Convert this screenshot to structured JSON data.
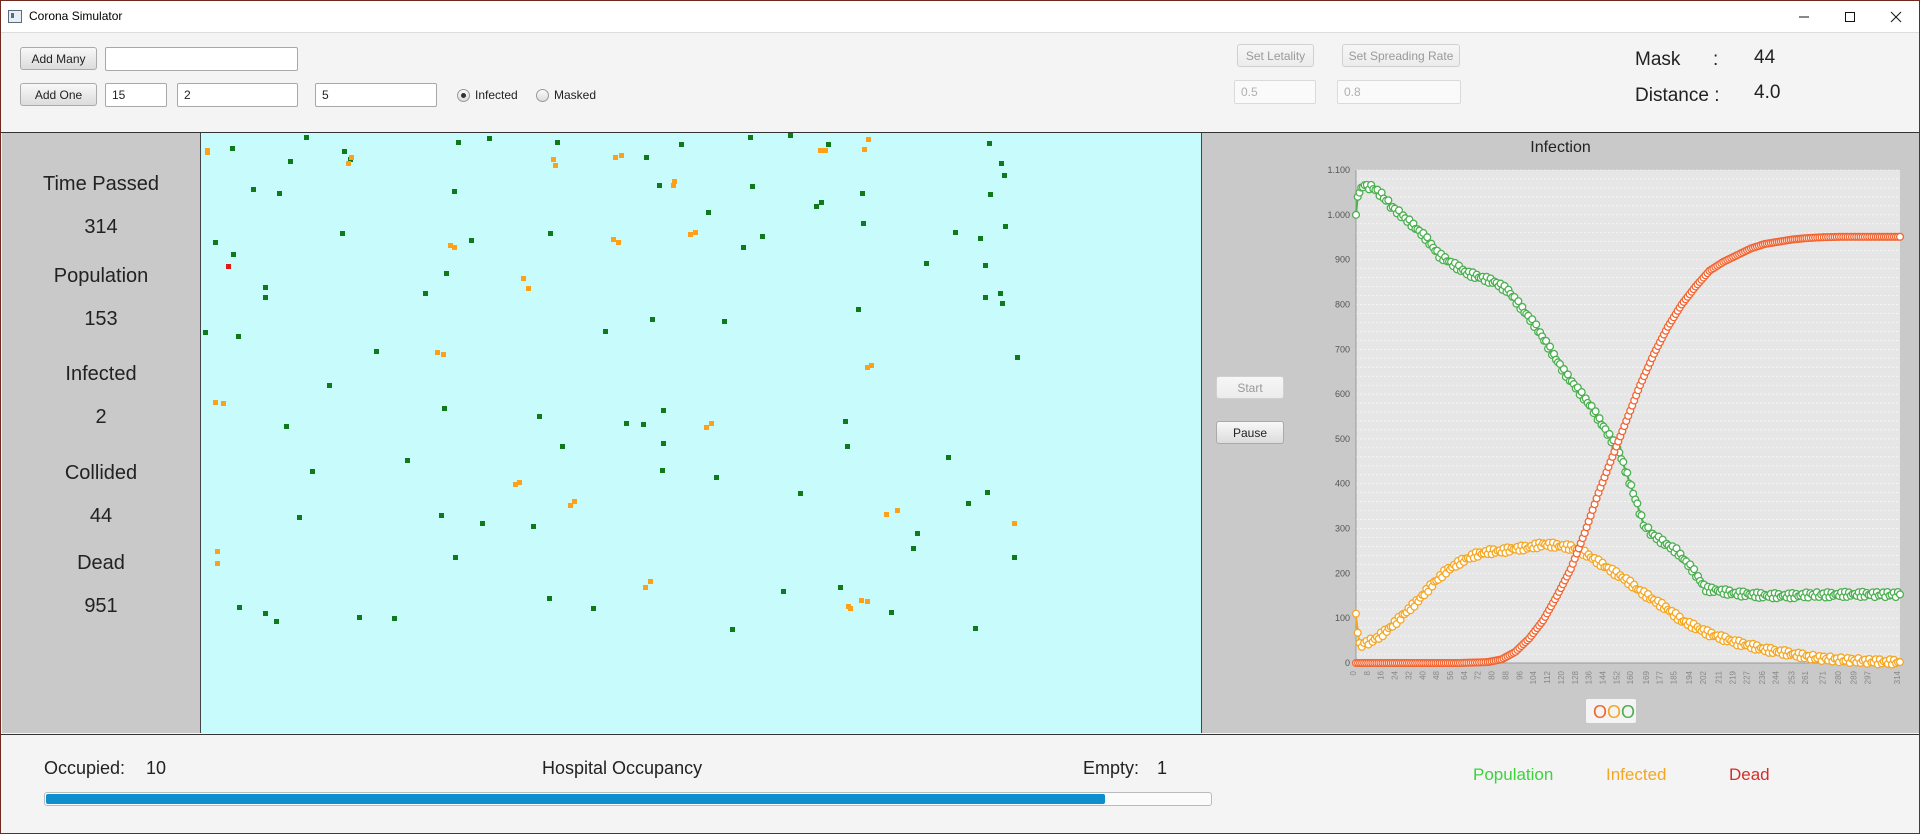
{
  "window": {
    "title": "Corona Simulator"
  },
  "toolbar": {
    "add_many_label": "Add Many",
    "add_many_value": "",
    "add_one_label": "Add One",
    "add_one_fields": [
      "15",
      "2",
      "5"
    ],
    "radio_infected": "Infected",
    "radio_masked": "Masked",
    "radio_selected": "Infected",
    "set_letality_label": "Set Letality",
    "letality_value": "0.5",
    "set_spreading_label": "Set Spreading Rate",
    "spreading_value": "0.8"
  },
  "params": {
    "mask_label": "Mask",
    "mask_sep": ":",
    "mask_value": "44",
    "distance_label": "Distance :",
    "distance_value": "4.0"
  },
  "stats": {
    "time_label": "Time Passed",
    "time_value": "314",
    "population_label": "Population",
    "population_value": "153",
    "infected_label": "Infected",
    "infected_value": "2",
    "collided_label": "Collided",
    "collided_value": "44",
    "dead_label": "Dead",
    "dead_value": "951"
  },
  "controls": {
    "start_label": "Start",
    "pause_label": "Pause"
  },
  "hospital": {
    "occupied_label": "Occupied:",
    "occupied_value": "10",
    "title": "Hospital Occupancy",
    "empty_label": "Empty:",
    "empty_value": "1",
    "occupancy_fraction": 0.91
  },
  "legend": {
    "population": "Population",
    "infected": "Infected",
    "dead": "Dead",
    "population_color": "#3bd43b",
    "infected_color": "#f5a623",
    "dead_color": "#d0302a"
  },
  "chart_data": {
    "type": "line",
    "title": "Infection",
    "ylim": [
      0,
      1100
    ],
    "yticks": [
      0,
      100,
      200,
      300,
      400,
      500,
      600,
      700,
      800,
      900,
      1000,
      1100
    ],
    "ytick_labels": [
      "0",
      "100",
      "200",
      "300",
      "400",
      "500",
      "600",
      "700",
      "800",
      "900",
      "1.000",
      "1.100"
    ],
    "xlim": [
      0,
      314
    ],
    "xticks": [
      0,
      8,
      16,
      24,
      32,
      40,
      48,
      56,
      64,
      72,
      80,
      88,
      96,
      104,
      112,
      120,
      128,
      136,
      144,
      152,
      160,
      169,
      177,
      185,
      194,
      202,
      211,
      219,
      227,
      236,
      244,
      253,
      261,
      271,
      280,
      289,
      297,
      314
    ],
    "grid": true,
    "legend_symbols": [
      "O",
      "O",
      "O"
    ],
    "legend_symbol_colors": [
      "#f26430",
      "#f5a623",
      "#4caf50"
    ],
    "series": [
      {
        "color": "#4caf50",
        "points": [
          [
            0,
            1000
          ],
          [
            1,
            1040
          ],
          [
            3,
            1060
          ],
          [
            5,
            1065
          ],
          [
            10,
            1060
          ],
          [
            16,
            1040
          ],
          [
            20,
            1020
          ],
          [
            26,
            1000
          ],
          [
            32,
            980
          ],
          [
            40,
            950
          ],
          [
            48,
            910
          ],
          [
            56,
            890
          ],
          [
            64,
            870
          ],
          [
            72,
            860
          ],
          [
            80,
            850
          ],
          [
            88,
            830
          ],
          [
            96,
            790
          ],
          [
            104,
            750
          ],
          [
            112,
            700
          ],
          [
            120,
            650
          ],
          [
            128,
            610
          ],
          [
            136,
            570
          ],
          [
            144,
            520
          ],
          [
            152,
            470
          ],
          [
            160,
            380
          ],
          [
            166,
            310
          ],
          [
            170,
            290
          ],
          [
            177,
            270
          ],
          [
            185,
            250
          ],
          [
            194,
            210
          ],
          [
            202,
            165
          ],
          [
            211,
            160
          ],
          [
            219,
            155
          ],
          [
            227,
            153
          ],
          [
            236,
            150
          ],
          [
            244,
            150
          ],
          [
            253,
            150
          ],
          [
            261,
            152
          ],
          [
            271,
            152
          ],
          [
            280,
            153
          ],
          [
            289,
            153
          ],
          [
            297,
            153
          ],
          [
            314,
            153
          ]
        ]
      },
      {
        "color": "#f5a623",
        "points": [
          [
            0,
            105
          ],
          [
            2,
            40
          ],
          [
            6,
            45
          ],
          [
            12,
            55
          ],
          [
            20,
            80
          ],
          [
            28,
            110
          ],
          [
            36,
            140
          ],
          [
            44,
            175
          ],
          [
            52,
            205
          ],
          [
            60,
            225
          ],
          [
            68,
            240
          ],
          [
            76,
            248
          ],
          [
            84,
            250
          ],
          [
            92,
            255
          ],
          [
            100,
            258
          ],
          [
            108,
            265
          ],
          [
            116,
            262
          ],
          [
            124,
            258
          ],
          [
            132,
            245
          ],
          [
            140,
            225
          ],
          [
            148,
            205
          ],
          [
            156,
            185
          ],
          [
            164,
            160
          ],
          [
            172,
            140
          ],
          [
            180,
            120
          ],
          [
            188,
            95
          ],
          [
            196,
            80
          ],
          [
            204,
            65
          ],
          [
            212,
            55
          ],
          [
            220,
            45
          ],
          [
            228,
            38
          ],
          [
            236,
            30
          ],
          [
            244,
            25
          ],
          [
            252,
            20
          ],
          [
            260,
            14
          ],
          [
            270,
            10
          ],
          [
            280,
            7
          ],
          [
            290,
            5
          ],
          [
            300,
            3
          ],
          [
            314,
            2
          ]
        ]
      },
      {
        "color": "#f26430",
        "points": [
          [
            0,
            0
          ],
          [
            20,
            0
          ],
          [
            40,
            0
          ],
          [
            60,
            0
          ],
          [
            76,
            2
          ],
          [
            84,
            8
          ],
          [
            92,
            25
          ],
          [
            100,
            55
          ],
          [
            108,
            95
          ],
          [
            116,
            150
          ],
          [
            124,
            210
          ],
          [
            132,
            290
          ],
          [
            140,
            380
          ],
          [
            148,
            460
          ],
          [
            156,
            540
          ],
          [
            164,
            620
          ],
          [
            172,
            690
          ],
          [
            180,
            750
          ],
          [
            188,
            800
          ],
          [
            196,
            840
          ],
          [
            204,
            875
          ],
          [
            212,
            895
          ],
          [
            220,
            910
          ],
          [
            228,
            925
          ],
          [
            236,
            935
          ],
          [
            244,
            940
          ],
          [
            252,
            945
          ],
          [
            260,
            948
          ],
          [
            270,
            950
          ],
          [
            280,
            951
          ],
          [
            290,
            951
          ],
          [
            300,
            951
          ],
          [
            314,
            951
          ]
        ]
      }
    ]
  }
}
